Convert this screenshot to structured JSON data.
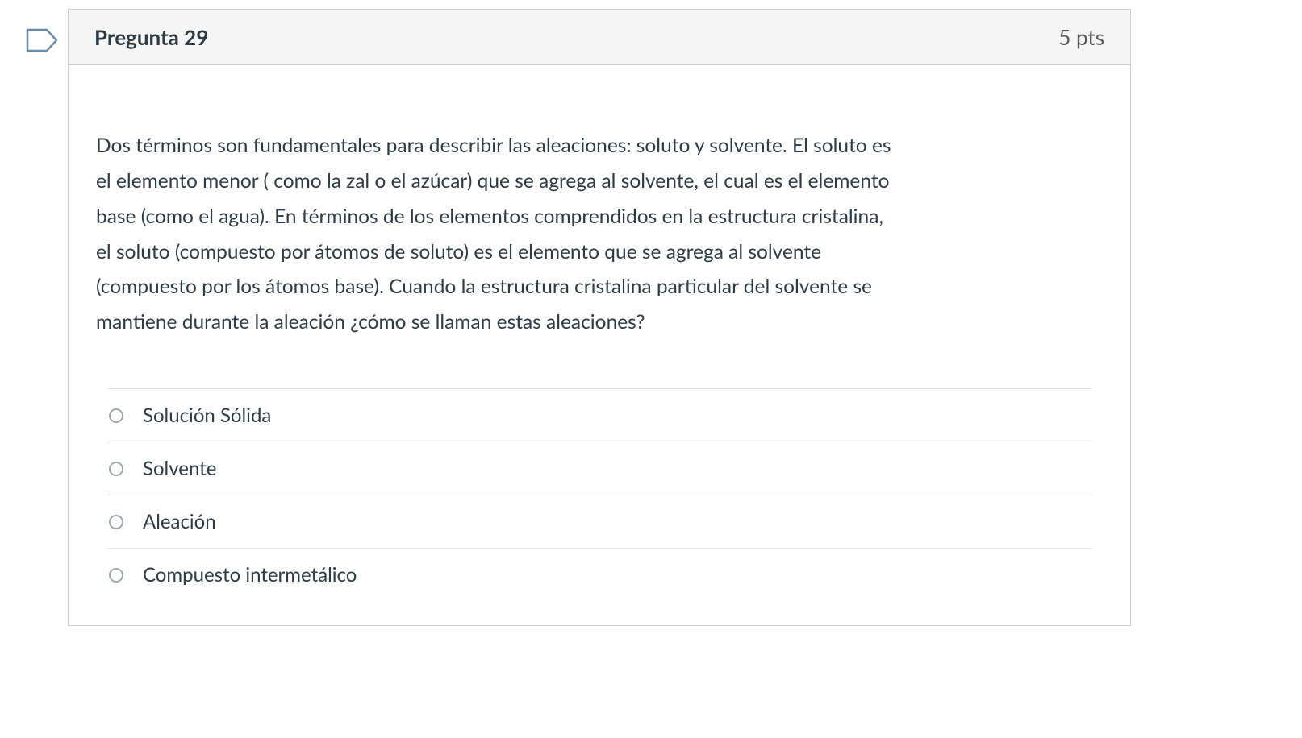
{
  "question": {
    "title": "Pregunta 29",
    "points": "5 pts",
    "text": "Dos términos son fundamentales para describir las aleaciones: soluto y solvente. El soluto es el elemento menor ( como la zal o el azúcar) que se agrega al solvente, el cual es el elemento base (como el agua). En términos de los elementos comprendidos en la estructura cristalina, el soluto (compuesto por átomos de soluto) es el elemento que se agrega al solvente (compuesto por los átomos base). Cuando la estructura cristalina particular del solvente se mantiene durante la aleación ¿cómo se llaman estas aleaciones?",
    "answers": [
      "Solución Sólida",
      "Solvente",
      "Aleación",
      "Compuesto intermetálico"
    ]
  }
}
